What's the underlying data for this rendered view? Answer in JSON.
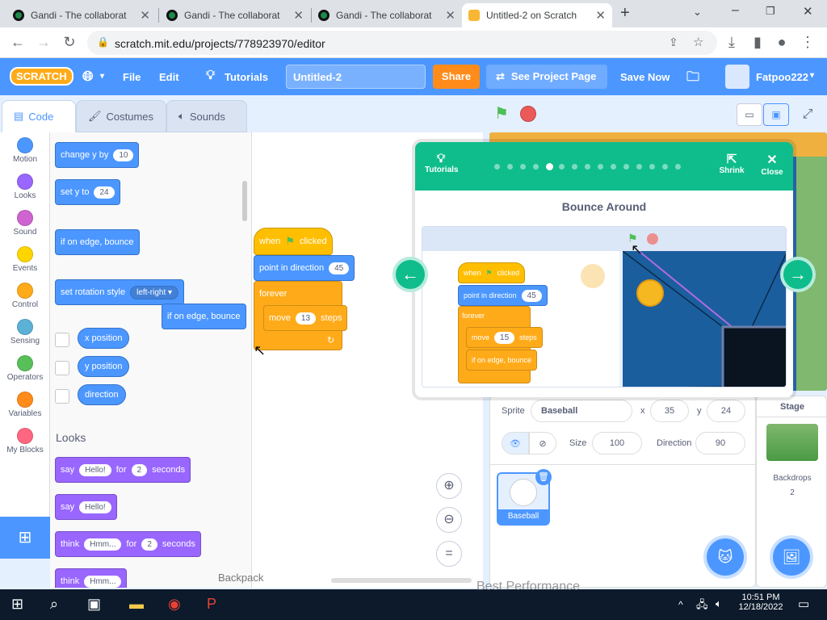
{
  "browser": {
    "tabs": [
      {
        "title": "Gandi - The collaborat"
      },
      {
        "title": "Gandi - The collaborat"
      },
      {
        "title": "Gandi - The collaborat"
      },
      {
        "title": "Untitled-2 on Scratch"
      }
    ],
    "new_tab": "+",
    "url": "scratch.mit.edu/projects/778923970/editor"
  },
  "menubar": {
    "logo": "SCRATCH",
    "file": "File",
    "edit": "Edit",
    "tutorials": "Tutorials",
    "project_title": "Untitled-2",
    "share": "Share",
    "see_project": "See Project Page",
    "save_now": "Save Now",
    "username": "Fatpoo222"
  },
  "editor_tabs": {
    "code": "Code",
    "costumes": "Costumes",
    "sounds": "Sounds"
  },
  "categories": [
    {
      "label": "Motion",
      "color": "#4c97ff"
    },
    {
      "label": "Looks",
      "color": "#9966ff"
    },
    {
      "label": "Sound",
      "color": "#cf63cf"
    },
    {
      "label": "Events",
      "color": "#ffd500"
    },
    {
      "label": "Control",
      "color": "#ffab19"
    },
    {
      "label": "Sensing",
      "color": "#5cb1d6"
    },
    {
      "label": "Operators",
      "color": "#59c059"
    },
    {
      "label": "Variables",
      "color": "#ff8c1a"
    },
    {
      "label": "My Blocks",
      "color": "#ff6680"
    }
  ],
  "palette": {
    "change_y": "change y by",
    "change_y_val": "10",
    "set_y": "set y to",
    "set_y_val": "24",
    "edge_bounce": "if on edge, bounce",
    "rotation": "set rotation style",
    "rotation_val": "left-right ▾",
    "dragging": "if on edge, bounce",
    "x_pos": "x position",
    "y_pos": "y position",
    "direction": "direction",
    "looks_heading": "Looks",
    "say1": "say",
    "say1_val": "Hello!",
    "say1_for": "for",
    "say1_secs": "2",
    "say1_unit": "seconds",
    "say2": "say",
    "say2_val": "Hello!",
    "think1": "think",
    "think1_val": "Hmm...",
    "think1_for": "for",
    "think1_secs": "2",
    "think1_unit": "seconds",
    "think2": "think",
    "think2_val": "Hmm..."
  },
  "script": {
    "when": "when",
    "clicked": "clicked",
    "point": "point in direction",
    "point_val": "45",
    "forever": "forever",
    "move": "move",
    "move_val": "13",
    "steps": "steps",
    "loop_arrow": "↻"
  },
  "backpack": "Backpack",
  "tutorial": {
    "tutorials_label": "Tutorials",
    "shrink": "Shrink",
    "close": "Close",
    "title": "Bounce Around",
    "total_steps": 15,
    "current_step": 4,
    "video": {
      "when": "when",
      "clicked": "clicked",
      "point": "point in direction",
      "point_val": "45",
      "forever": "forever",
      "move": "move",
      "move_val": "15",
      "steps": "steps",
      "bounce": "if on edge, bounce"
    }
  },
  "sprite_info": {
    "sprite_label": "Sprite",
    "sprite_name": "Baseball",
    "x_label": "x",
    "x": "35",
    "y_label": "y",
    "y": "24",
    "size_label": "Size",
    "size": "100",
    "direction_label": "Direction",
    "direction": "90"
  },
  "sprites": [
    {
      "name": "Baseball"
    }
  ],
  "stage_panel": {
    "title": "Stage",
    "backdrops_label": "Backdrops",
    "backdrops_count": "2"
  },
  "taskbar": {
    "time": "10:51 PM",
    "date": "12/18/2022",
    "faded_text": "Best Performance"
  }
}
